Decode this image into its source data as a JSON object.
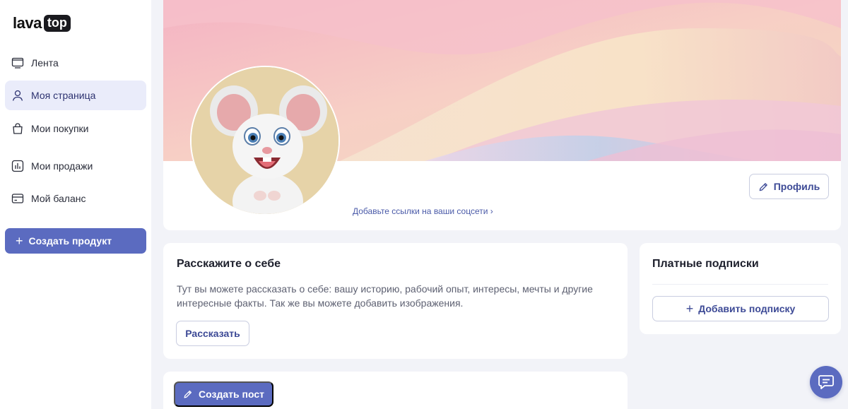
{
  "brand": {
    "logo_word": "lava",
    "logo_badge": "top"
  },
  "sidebar": {
    "items": [
      {
        "label": "Лента",
        "icon": "monitor-icon",
        "active": false
      },
      {
        "label": "Моя страница",
        "icon": "user-icon",
        "active": true
      },
      {
        "label": "Мои покупки",
        "icon": "bag-icon",
        "active": false
      },
      {
        "label": "Мои продажи",
        "icon": "chart-icon",
        "active": false
      },
      {
        "label": "Мой баланс",
        "icon": "wallet-icon",
        "active": false
      }
    ],
    "create_product": {
      "plus": "+",
      "label": "Создать продукт"
    }
  },
  "profile": {
    "social_link": "Добавьте ссылки на ваши соцсети ›",
    "profile_button": "Профиль"
  },
  "about": {
    "title": "Расскажите о себе",
    "text": "Тут вы можете рассказать о себе: вашу историю, рабочий опыт, интересы, мечты и другие интересные факты. Так же вы можете добавить изображения.",
    "button": "Рассказать"
  },
  "subscriptions": {
    "title": "Платные подписки",
    "add_plus": "+",
    "add_button": "Добавить подписку"
  },
  "posts": {
    "create_button": "Создать пост"
  },
  "colors": {
    "accent": "#5b6bc0",
    "active_nav_bg": "#eaecfa",
    "page_bg": "#f2f3f8",
    "link": "#4a5aa8"
  }
}
